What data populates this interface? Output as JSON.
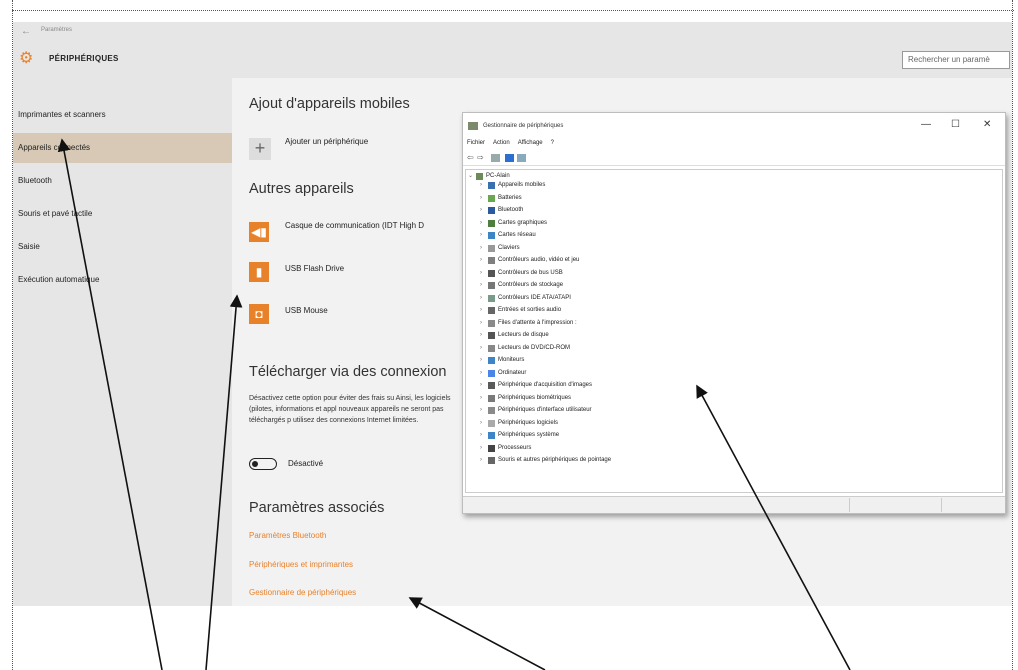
{
  "window": {
    "back_glyph": "←",
    "app_title": "Paramètres",
    "section_title": "PÉRIPHÉRIQUES",
    "search_placeholder": "Rechercher un paramè"
  },
  "nav": {
    "items": [
      {
        "label": "Imprimantes et scanners"
      },
      {
        "label": "Appareils connectés"
      },
      {
        "label": "Bluetooth"
      },
      {
        "label": "Souris et pavé tactile"
      },
      {
        "label": "Saisie"
      },
      {
        "label": "Exécution automatique"
      }
    ],
    "selected_index": 1
  },
  "content": {
    "section1_title": "Ajout d'appareils mobiles",
    "add_device_label": "Ajouter un périphérique",
    "section2_title": "Autres appareils",
    "devices": [
      {
        "label": "Casque de communication (IDT High D",
        "icon": "speaker-icon"
      },
      {
        "label": "USB Flash Drive",
        "icon": "usb-drive-icon"
      },
      {
        "label": "USB Mouse",
        "icon": "mouse-icon"
      }
    ],
    "section3_title": "Télécharger via des connexion",
    "metered_desc": "Désactivez cette option pour éviter des frais su Ainsi, les logiciels (pilotes, informations et appl nouveaux appareils ne seront pas téléchargés p utilisez des connexions Internet limitées.",
    "toggle_state": "Désactivé",
    "section4_title": "Paramètres associés",
    "related_links": [
      "Paramètres Bluetooth",
      "Périphériques et imprimantes",
      "Gestionnaire de périphériques"
    ]
  },
  "device_manager": {
    "title": "Gestionnaire de périphériques",
    "controls": {
      "minimize": "—",
      "maximize": "☐",
      "close": "✕"
    },
    "menu": [
      "Fichier",
      "Action",
      "Affichage",
      "?"
    ],
    "root": "PC-Alain",
    "categories": [
      "Appareils mobiles",
      "Batteries",
      "Bluetooth",
      "Cartes graphiques",
      "Cartes réseau",
      "Claviers",
      "Contrôleurs audio, vidéo et jeu",
      "Contrôleurs de bus USB",
      "Contrôleurs de stockage",
      "Contrôleurs IDE ATA/ATAPI",
      "Entrées et sorties audio",
      "Files d'attente à l'impression :",
      "Lecteurs de disque",
      "Lecteurs de DVD/CD-ROM",
      "Moniteurs",
      "Ordinateur",
      "Périphérique d'acquisition d'images",
      "Périphériques biométriques",
      "Périphériques d'interface utilisateur",
      "Périphériques logiciels",
      "Périphériques système",
      "Processeurs",
      "Souris et autres périphériques de pointage"
    ]
  },
  "colors": {
    "accent": "#e8822a",
    "nav_selected": "#d7c9b5",
    "pane_bg": "#e6e6e6",
    "content_bg": "#f2f2f2"
  }
}
